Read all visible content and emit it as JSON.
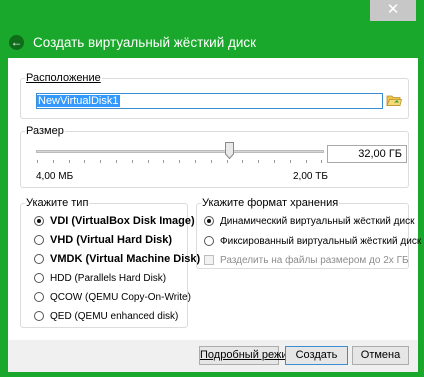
{
  "window": {
    "close_glyph": "✕",
    "back_glyph": "←",
    "title": "Создать виртуальный жёсткий диск",
    "accent_color": "#19a82b"
  },
  "location": {
    "legend": "Расположение",
    "value": "NewVirtualDisk1",
    "folder_icon": "folder-icon"
  },
  "size": {
    "legend": "Размер",
    "value": "32,00 ГБ",
    "min_label": "4,00 МБ",
    "max_label": "2,00 ТБ",
    "slider_level": 0.67
  },
  "disk_type": {
    "legend": "Укажите тип",
    "options": [
      {
        "label": "VDI (VirtualBox Disk Image)",
        "selected": true
      },
      {
        "label": "VHD (Virtual Hard Disk)",
        "selected": false
      },
      {
        "label": "VMDK (Virtual Machine Disk)",
        "selected": false
      },
      {
        "label": "HDD (Parallels Hard Disk)",
        "selected": false
      },
      {
        "label": "QCOW (QEMU Copy-On-Write)",
        "selected": false
      },
      {
        "label": "QED (QEMU enhanced disk)",
        "selected": false
      }
    ]
  },
  "storage_format": {
    "legend": "Укажите формат хранения",
    "options": [
      {
        "label": "Динамический виртуальный жёсткий диск",
        "selected": true
      },
      {
        "label": "Фиксированный виртуальный жёсткий диск",
        "selected": false
      }
    ],
    "split_label": "Разделить на файлы размером до 2х ГБ",
    "split_enabled": false
  },
  "buttons": {
    "expert": "Подробный режим",
    "create": "Создать",
    "cancel": "Отмена"
  }
}
